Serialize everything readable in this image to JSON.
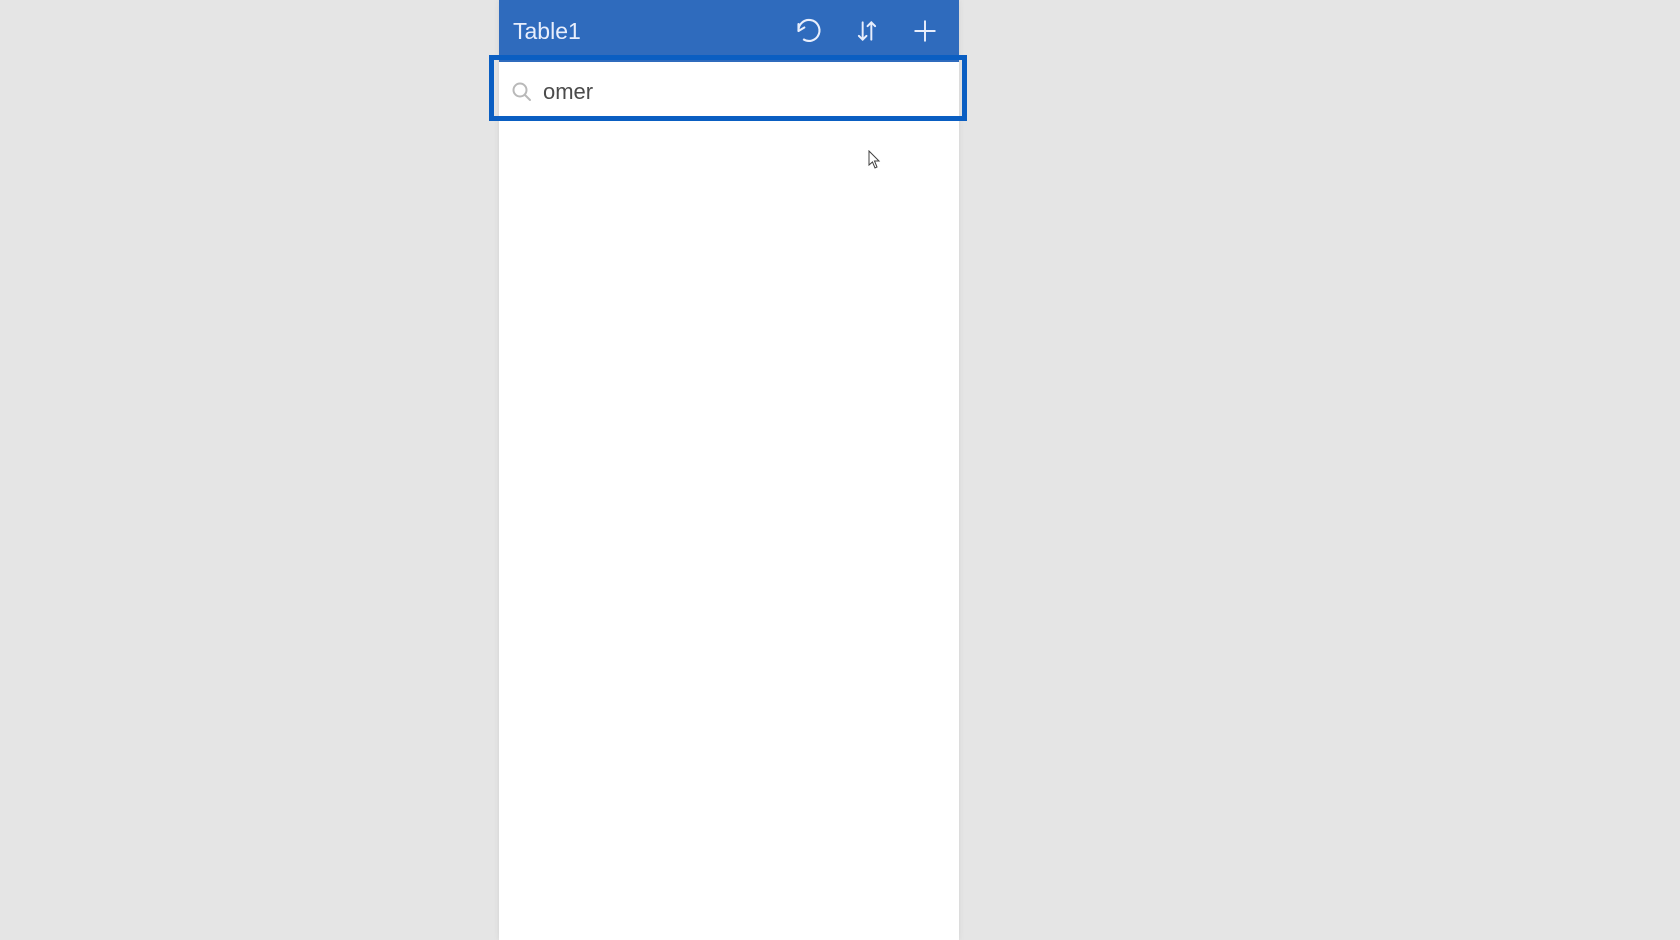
{
  "header": {
    "title": "Table1",
    "icons": {
      "refresh": "refresh-icon",
      "sort": "sort-icon",
      "add": "plus-icon"
    }
  },
  "search": {
    "value": "omer",
    "placeholder": ""
  },
  "colors": {
    "headerBg": "#2f6bbd",
    "highlightBorder": "#0a5ec2",
    "bodyBg": "#e5e5e5",
    "panelBg": "#ffffff"
  }
}
